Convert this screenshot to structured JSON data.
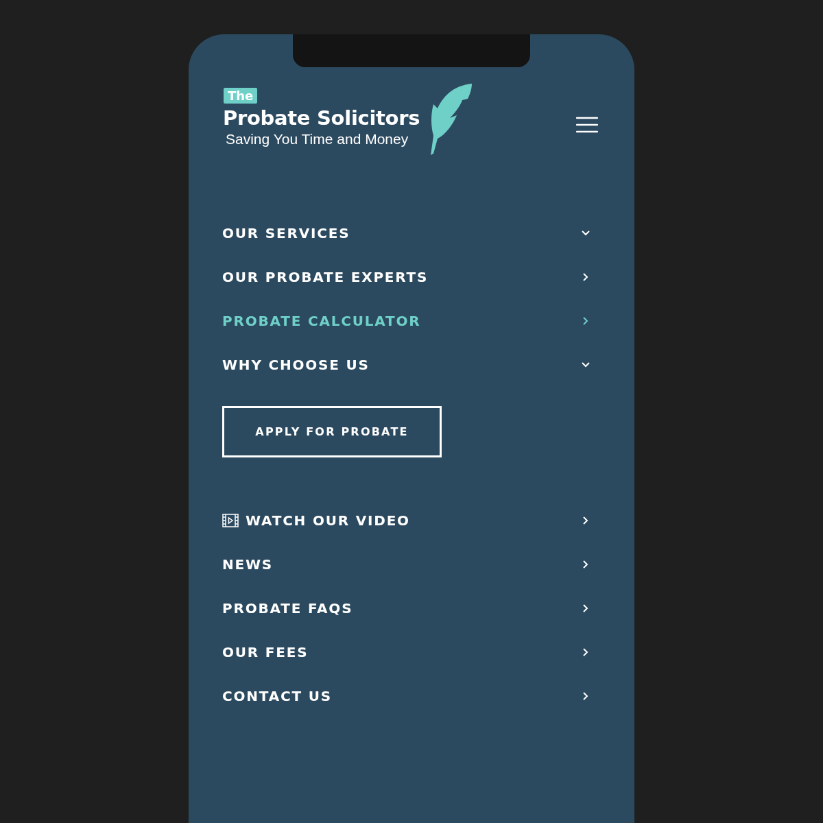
{
  "logo": {
    "badge": "The",
    "name": "Probate Solicitors",
    "tagline": "Saving You Time and Money"
  },
  "menu": [
    {
      "label": "OUR SERVICES",
      "kind": "dropdown",
      "selected": false
    },
    {
      "label": "OUR PROBATE EXPERTS",
      "kind": "link",
      "selected": false
    },
    {
      "label": "PROBATE CALCULATOR",
      "kind": "link",
      "selected": true
    },
    {
      "label": "WHY CHOOSE US",
      "kind": "dropdown",
      "selected": false
    }
  ],
  "cta_button": "APPLY FOR PROBATE",
  "secondary_menu": [
    {
      "label": "WATCH OUR VIDEO",
      "kind": "video",
      "selected": false
    },
    {
      "label": "NEWS",
      "kind": "link",
      "selected": false
    },
    {
      "label": "PROBATE FAQS",
      "kind": "link",
      "selected": false
    },
    {
      "label": "OUR FEES",
      "kind": "link",
      "selected": false
    },
    {
      "label": "CONTACT US",
      "kind": "link",
      "selected": false
    }
  ]
}
